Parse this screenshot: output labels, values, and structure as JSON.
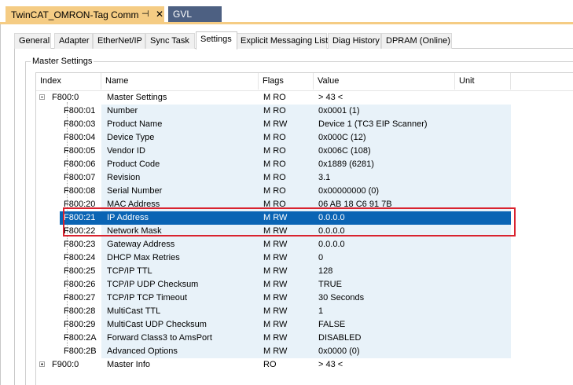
{
  "document_tabs": [
    {
      "label": "TwinCAT_OMRON-Tag Comm",
      "active": true,
      "pin_glyph": "⊣",
      "close_glyph": "✕"
    },
    {
      "label": "GVL",
      "active": false
    }
  ],
  "property_tabs": [
    {
      "label": "General"
    },
    {
      "label": "Adapter"
    },
    {
      "label": "EtherNet/IP"
    },
    {
      "label": "Sync Task"
    },
    {
      "label": "Settings",
      "active": true
    },
    {
      "label": "Explicit Messaging List"
    },
    {
      "label": "Diag History"
    },
    {
      "label": "DPRAM (Online)"
    }
  ],
  "group_title": "Master Settings",
  "columns": {
    "index": "Index",
    "name": "Name",
    "flags": "Flags",
    "value": "Value",
    "unit": "Unit"
  },
  "rows": [
    {
      "index": "F800:0",
      "name": "Master Settings",
      "flags": "M RO",
      "value": "> 43 <",
      "level": 0,
      "expander": "minus"
    },
    {
      "index": "F800:01",
      "name": "Number",
      "flags": "M RO",
      "value": "0x0001 (1)",
      "level": 1
    },
    {
      "index": "F800:03",
      "name": "Product Name",
      "flags": "M RW",
      "value": "Device 1 (TC3 EIP Scanner)",
      "level": 1
    },
    {
      "index": "F800:04",
      "name": "Device Type",
      "flags": "M RO",
      "value": "0x000C (12)",
      "level": 1
    },
    {
      "index": "F800:05",
      "name": "Vendor ID",
      "flags": "M RO",
      "value": "0x006C (108)",
      "level": 1
    },
    {
      "index": "F800:06",
      "name": "Product Code",
      "flags": "M RO",
      "value": "0x1889 (6281)",
      "level": 1
    },
    {
      "index": "F800:07",
      "name": "Revision",
      "flags": "M RO",
      "value": "3.1",
      "level": 1
    },
    {
      "index": "F800:08",
      "name": "Serial Number",
      "flags": "M RO",
      "value": "0x00000000 (0)",
      "level": 1
    },
    {
      "index": "F800:20",
      "name": "MAC Address",
      "flags": "M RO",
      "value": "06 AB 18 C6 91 7B",
      "level": 1
    },
    {
      "index": "F800:21",
      "name": "IP Address",
      "flags": "M RW",
      "value": "0.0.0.0",
      "level": 1,
      "selected": true
    },
    {
      "index": "F800:22",
      "name": "Network Mask",
      "flags": "M RW",
      "value": "0.0.0.0",
      "level": 1
    },
    {
      "index": "F800:23",
      "name": "Gateway Address",
      "flags": "M RW",
      "value": "0.0.0.0",
      "level": 1
    },
    {
      "index": "F800:24",
      "name": "DHCP Max Retries",
      "flags": "M RW",
      "value": "0",
      "level": 1
    },
    {
      "index": "F800:25",
      "name": "TCP/IP TTL",
      "flags": "M RW",
      "value": "128",
      "level": 1
    },
    {
      "index": "F800:26",
      "name": "TCP/IP UDP Checksum",
      "flags": "M RW",
      "value": "TRUE",
      "level": 1
    },
    {
      "index": "F800:27",
      "name": "TCP/IP TCP Timeout",
      "flags": "M RW",
      "value": "30 Seconds",
      "level": 1
    },
    {
      "index": "F800:28",
      "name": "MultiCast TTL",
      "flags": "M RW",
      "value": "1",
      "level": 1
    },
    {
      "index": "F800:29",
      "name": "MultiCast UDP Checksum",
      "flags": "M RW",
      "value": "FALSE",
      "level": 1
    },
    {
      "index": "F800:2A",
      "name": "Forward Class3 to AmsPort",
      "flags": "M RW",
      "value": "DISABLED",
      "level": 1
    },
    {
      "index": "F800:2B",
      "name": "Advanced Options",
      "flags": "M RW",
      "value": "0x0000 (0)",
      "level": 1
    },
    {
      "index": "F900:0",
      "name": "Master Info",
      "flags": "RO",
      "value": "> 43 <",
      "level": 0,
      "expander": "plus"
    }
  ],
  "colors": {
    "accent_tab": "#f5cc84",
    "selection": "#0a64b4",
    "highlight_box": "#d9232f",
    "row_tint": "#e8f2f9"
  }
}
